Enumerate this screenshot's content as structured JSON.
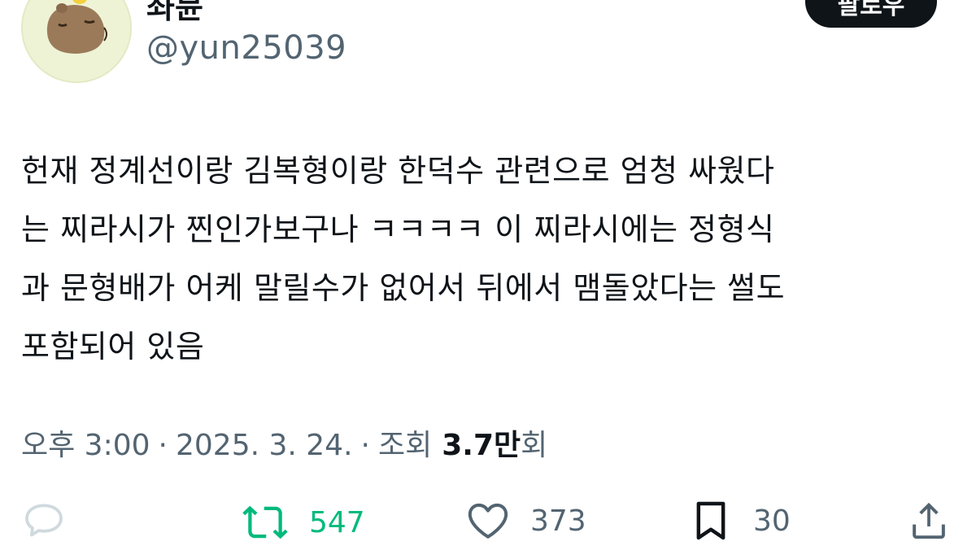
{
  "user": {
    "display_name": "좌뮨",
    "handle": "@yun25039"
  },
  "follow_label": "팔로우",
  "tweet": {
    "lines": [
      "헌재 정계선이랑 김복형이랑 한덕수 관련으로 엄청 싸웠다",
      "는 찌라시가 찐인가보구나 ㅋㅋㅋㅋ 이 찌라시에는 정형식",
      "과 문형배가 어케 말릴수가 없어서 뒤에서 맴돌았다는 썰도",
      "포함되어 있음"
    ]
  },
  "meta": {
    "time": "오후 3:00",
    "separator": "·",
    "date": "2025. 3. 24.",
    "views_label": "조회",
    "views_number": "3.7",
    "views_unit": "만",
    "views_suffix": "회"
  },
  "actions": {
    "retweets": "547",
    "likes": "373",
    "bookmarks": "30"
  },
  "colors": {
    "text": "#0f1419",
    "secondary": "#536471",
    "retweet_green": "#00ba7c",
    "reply_icon": "#cfd9de"
  },
  "icons": {
    "reply": "speech-bubble-icon",
    "retweet": "retweet-arrows-icon",
    "like": "heart-outline-icon",
    "bookmark": "bookmark-outline-icon",
    "share": "share-upload-icon"
  }
}
